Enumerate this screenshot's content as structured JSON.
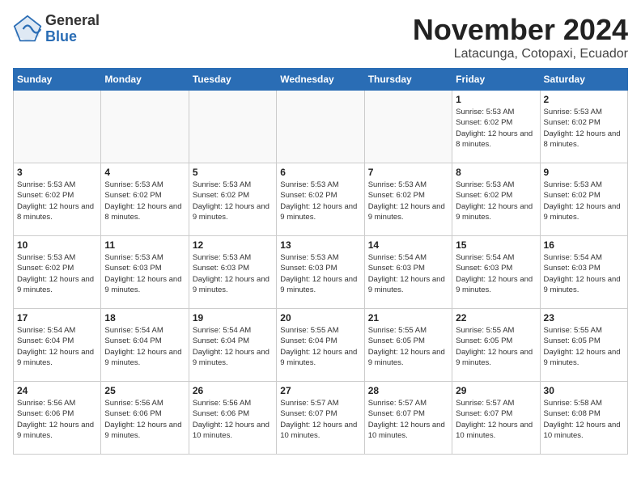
{
  "header": {
    "logo_general": "General",
    "logo_blue": "Blue",
    "month_title": "November 2024",
    "location": "Latacunga, Cotopaxi, Ecuador"
  },
  "weekdays": [
    "Sunday",
    "Monday",
    "Tuesday",
    "Wednesday",
    "Thursday",
    "Friday",
    "Saturday"
  ],
  "weeks": [
    [
      {
        "day": "",
        "info": ""
      },
      {
        "day": "",
        "info": ""
      },
      {
        "day": "",
        "info": ""
      },
      {
        "day": "",
        "info": ""
      },
      {
        "day": "",
        "info": ""
      },
      {
        "day": "1",
        "info": "Sunrise: 5:53 AM\nSunset: 6:02 PM\nDaylight: 12 hours and 8 minutes."
      },
      {
        "day": "2",
        "info": "Sunrise: 5:53 AM\nSunset: 6:02 PM\nDaylight: 12 hours and 8 minutes."
      }
    ],
    [
      {
        "day": "3",
        "info": "Sunrise: 5:53 AM\nSunset: 6:02 PM\nDaylight: 12 hours and 8 minutes."
      },
      {
        "day": "4",
        "info": "Sunrise: 5:53 AM\nSunset: 6:02 PM\nDaylight: 12 hours and 8 minutes."
      },
      {
        "day": "5",
        "info": "Sunrise: 5:53 AM\nSunset: 6:02 PM\nDaylight: 12 hours and 9 minutes."
      },
      {
        "day": "6",
        "info": "Sunrise: 5:53 AM\nSunset: 6:02 PM\nDaylight: 12 hours and 9 minutes."
      },
      {
        "day": "7",
        "info": "Sunrise: 5:53 AM\nSunset: 6:02 PM\nDaylight: 12 hours and 9 minutes."
      },
      {
        "day": "8",
        "info": "Sunrise: 5:53 AM\nSunset: 6:02 PM\nDaylight: 12 hours and 9 minutes."
      },
      {
        "day": "9",
        "info": "Sunrise: 5:53 AM\nSunset: 6:02 PM\nDaylight: 12 hours and 9 minutes."
      }
    ],
    [
      {
        "day": "10",
        "info": "Sunrise: 5:53 AM\nSunset: 6:02 PM\nDaylight: 12 hours and 9 minutes."
      },
      {
        "day": "11",
        "info": "Sunrise: 5:53 AM\nSunset: 6:03 PM\nDaylight: 12 hours and 9 minutes."
      },
      {
        "day": "12",
        "info": "Sunrise: 5:53 AM\nSunset: 6:03 PM\nDaylight: 12 hours and 9 minutes."
      },
      {
        "day": "13",
        "info": "Sunrise: 5:53 AM\nSunset: 6:03 PM\nDaylight: 12 hours and 9 minutes."
      },
      {
        "day": "14",
        "info": "Sunrise: 5:54 AM\nSunset: 6:03 PM\nDaylight: 12 hours and 9 minutes."
      },
      {
        "day": "15",
        "info": "Sunrise: 5:54 AM\nSunset: 6:03 PM\nDaylight: 12 hours and 9 minutes."
      },
      {
        "day": "16",
        "info": "Sunrise: 5:54 AM\nSunset: 6:03 PM\nDaylight: 12 hours and 9 minutes."
      }
    ],
    [
      {
        "day": "17",
        "info": "Sunrise: 5:54 AM\nSunset: 6:04 PM\nDaylight: 12 hours and 9 minutes."
      },
      {
        "day": "18",
        "info": "Sunrise: 5:54 AM\nSunset: 6:04 PM\nDaylight: 12 hours and 9 minutes."
      },
      {
        "day": "19",
        "info": "Sunrise: 5:54 AM\nSunset: 6:04 PM\nDaylight: 12 hours and 9 minutes."
      },
      {
        "day": "20",
        "info": "Sunrise: 5:55 AM\nSunset: 6:04 PM\nDaylight: 12 hours and 9 minutes."
      },
      {
        "day": "21",
        "info": "Sunrise: 5:55 AM\nSunset: 6:05 PM\nDaylight: 12 hours and 9 minutes."
      },
      {
        "day": "22",
        "info": "Sunrise: 5:55 AM\nSunset: 6:05 PM\nDaylight: 12 hours and 9 minutes."
      },
      {
        "day": "23",
        "info": "Sunrise: 5:55 AM\nSunset: 6:05 PM\nDaylight: 12 hours and 9 minutes."
      }
    ],
    [
      {
        "day": "24",
        "info": "Sunrise: 5:56 AM\nSunset: 6:06 PM\nDaylight: 12 hours and 9 minutes."
      },
      {
        "day": "25",
        "info": "Sunrise: 5:56 AM\nSunset: 6:06 PM\nDaylight: 12 hours and 9 minutes."
      },
      {
        "day": "26",
        "info": "Sunrise: 5:56 AM\nSunset: 6:06 PM\nDaylight: 12 hours and 10 minutes."
      },
      {
        "day": "27",
        "info": "Sunrise: 5:57 AM\nSunset: 6:07 PM\nDaylight: 12 hours and 10 minutes."
      },
      {
        "day": "28",
        "info": "Sunrise: 5:57 AM\nSunset: 6:07 PM\nDaylight: 12 hours and 10 minutes."
      },
      {
        "day": "29",
        "info": "Sunrise: 5:57 AM\nSunset: 6:07 PM\nDaylight: 12 hours and 10 minutes."
      },
      {
        "day": "30",
        "info": "Sunrise: 5:58 AM\nSunset: 6:08 PM\nDaylight: 12 hours and 10 minutes."
      }
    ]
  ]
}
